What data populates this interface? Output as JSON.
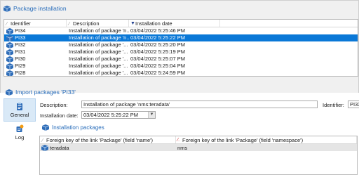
{
  "top_panel": {
    "title": "Package installation",
    "columns": [
      {
        "label": "Identifier"
      },
      {
        "label": "Description"
      },
      {
        "label": "Installation date",
        "sorted": "descending"
      }
    ],
    "rows": [
      {
        "id": "PI34",
        "description": "Installation of package 'n...",
        "date": "03/04/2022 5:25:46 PM",
        "selected": false
      },
      {
        "id": "PI33",
        "description": "Installation of package 'n...",
        "date": "03/04/2022 5:25:22 PM",
        "selected": true
      },
      {
        "id": "PI32",
        "description": "Installation of package '...",
        "date": "03/04/2022 5:25:20 PM",
        "selected": false
      },
      {
        "id": "PI31",
        "description": "Installation of package '...",
        "date": "03/04/2022 5:25:19 PM",
        "selected": false
      },
      {
        "id": "PI30",
        "description": "Installation of package '...",
        "date": "03/04/2022 5:25:07 PM",
        "selected": false
      },
      {
        "id": "PI29",
        "description": "Installation of package '...",
        "date": "03/04/2022 5:25:04 PM",
        "selected": false
      },
      {
        "id": "PI28",
        "description": "Installation of package '...",
        "date": "03/04/2022 5:24:59 PM",
        "selected": false
      }
    ]
  },
  "detail": {
    "title": "Import packages 'PI33'",
    "tabs": [
      {
        "label": "General",
        "icon": "clipboard-icon",
        "active": true
      },
      {
        "label": "Log",
        "icon": "log-icon",
        "active": false
      }
    ],
    "description_label": "Description:",
    "description_value": "Installation of package 'nms:teradata'",
    "identifier_label": "Identifier:",
    "identifier_value": "PI33",
    "date_label": "Installation date:",
    "date_value": "03/04/2022 5:25:22 PM",
    "packages_title": "Installation packages",
    "packages_columns": [
      {
        "label": "Foreign key of the link 'Package' (field 'name')"
      },
      {
        "label": "Foreign key of the link 'Package' (field 'namespace')"
      }
    ],
    "packages_rows": [
      {
        "name": "teradata",
        "namespace": "nms"
      }
    ]
  },
  "colors": {
    "accent": "#2a6ebb",
    "selection": "#0a78d7"
  }
}
